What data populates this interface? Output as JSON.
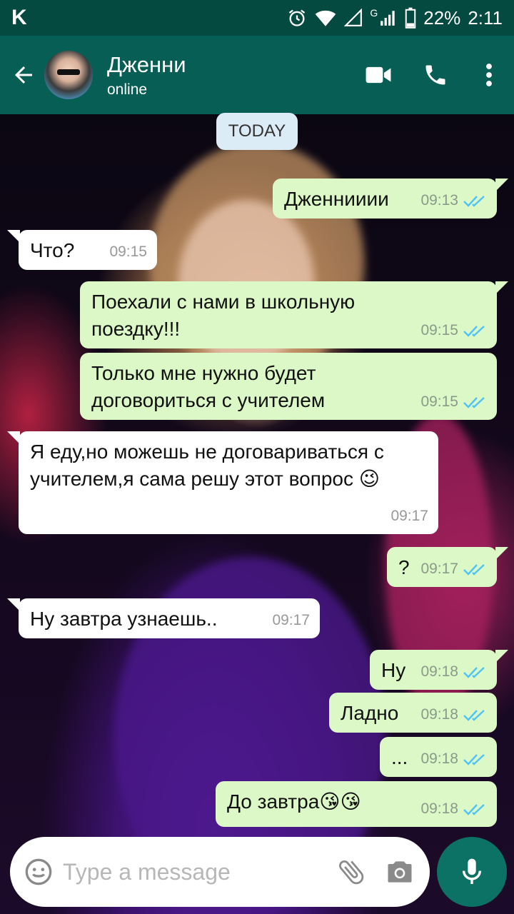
{
  "status_bar": {
    "app_letter": "K",
    "signal_g": "G",
    "battery": "22%",
    "time": "2:11"
  },
  "header": {
    "contact_name": "Дженни",
    "contact_status": "online"
  },
  "date_chip": "TODAY",
  "messages": [
    {
      "direction": "out",
      "text": "Дженнииии",
      "time": "09:13",
      "read": true
    },
    {
      "direction": "in",
      "text": "Что?",
      "time": "09:15"
    },
    {
      "direction": "out",
      "text": "Поехали с нами в школьную поездку!!!",
      "time": "09:15",
      "read": true
    },
    {
      "direction": "out",
      "text": "Только мне нужно будет договориться с учителем",
      "time": "09:15",
      "read": true
    },
    {
      "direction": "in",
      "text": "Я еду,но можешь не договариваться с учителем,я сама решу этот вопрос 😉",
      "time": "09:17"
    },
    {
      "direction": "out",
      "text": "?",
      "time": "09:17",
      "read": true
    },
    {
      "direction": "in",
      "text": "Ну завтра узнаешь..",
      "time": "09:17"
    },
    {
      "direction": "out",
      "text": "Ну",
      "time": "09:18",
      "read": true
    },
    {
      "direction": "out",
      "text": "Ладно",
      "time": "09:18",
      "read": true
    },
    {
      "direction": "out",
      "text": "...",
      "time": "09:18",
      "read": true
    },
    {
      "direction": "out",
      "text": "До завтра😘😘",
      "time": "09:18",
      "read": true
    }
  ],
  "composer": {
    "placeholder": "Type a message"
  },
  "colors": {
    "header": "#075e54",
    "status_bar": "#054a41",
    "outgoing_bubble": "#dcf8c6",
    "incoming_bubble": "#ffffff",
    "read_ticks": "#4fc3f7",
    "mic_button": "#0b7265"
  }
}
